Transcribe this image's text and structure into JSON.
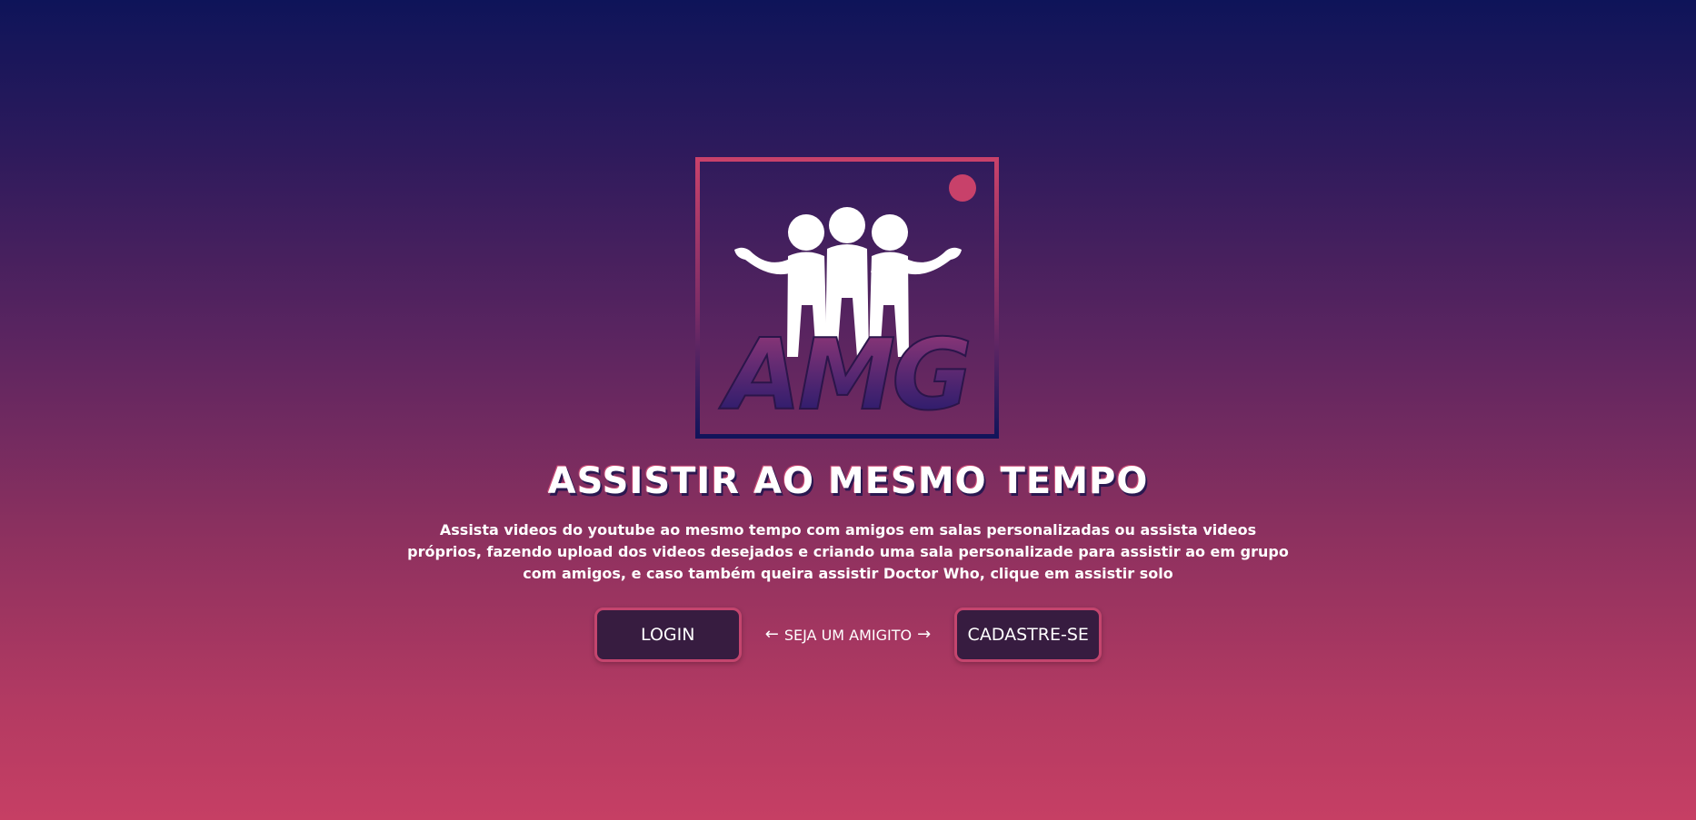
{
  "logo": {
    "text": "AMG",
    "colors": {
      "frame_top": "#c8416a",
      "frame_bottom": "#12145a",
      "letters_top": "#9a3a78",
      "letters_bottom": "#1a176a",
      "dot": "#c8416a"
    }
  },
  "headline": "ASSISTIR AO MESMO TEMPO",
  "description": "Assista videos do youtube ao mesmo tempo com amigos em salas personalizadas ou assista videos próprios, fazendo upload dos videos desejados e criando uma sala personalizade para assistir ao em grupo com amigos, e caso também queira assistir Doctor Who, clique em assistir solo",
  "actions": {
    "login_label": "LOGIN",
    "middle": {
      "left_arrow": "←",
      "text": "SEJA UM AMIGITO",
      "right_arrow": "→"
    },
    "signup_label": "CADASTRE-SE"
  },
  "colors": {
    "bg_top": "#0e1459",
    "bg_bottom": "#c63f64",
    "button_bg": "#371c40",
    "button_border": "#c4456e"
  }
}
